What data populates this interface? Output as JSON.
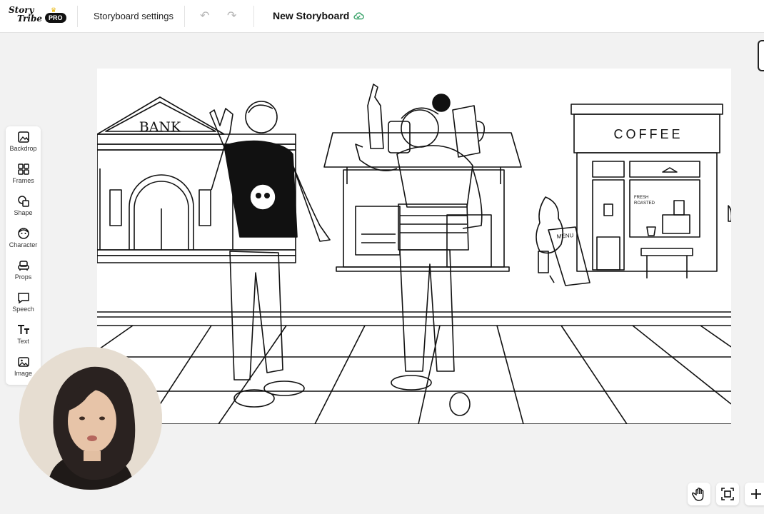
{
  "app": {
    "logo_line1": "Story",
    "logo_line2": "Tribe",
    "pro_badge": "PRO"
  },
  "header": {
    "settings_label": "Storyboard settings",
    "title": "New Storyboard"
  },
  "tools": [
    {
      "label": "Backdrop",
      "icon": "backdrop-icon"
    },
    {
      "label": "Frames",
      "icon": "frames-icon"
    },
    {
      "label": "Shape",
      "icon": "shape-icon"
    },
    {
      "label": "Character",
      "icon": "character-icon"
    },
    {
      "label": "Props",
      "icon": "props-icon"
    },
    {
      "label": "Speech",
      "icon": "speech-icon"
    },
    {
      "label": "Text",
      "icon": "text-icon"
    },
    {
      "label": "Image",
      "icon": "image-icon"
    }
  ],
  "scene": {
    "bank_sign": "BANK",
    "coffee_sign": "COFFEE",
    "fresh_line1": "FRESH",
    "fresh_line2": "ROASTED",
    "menu_sign": "MENU"
  },
  "colors": {
    "accent_cloud": "#3aa36a",
    "crown": "#e8b400"
  }
}
